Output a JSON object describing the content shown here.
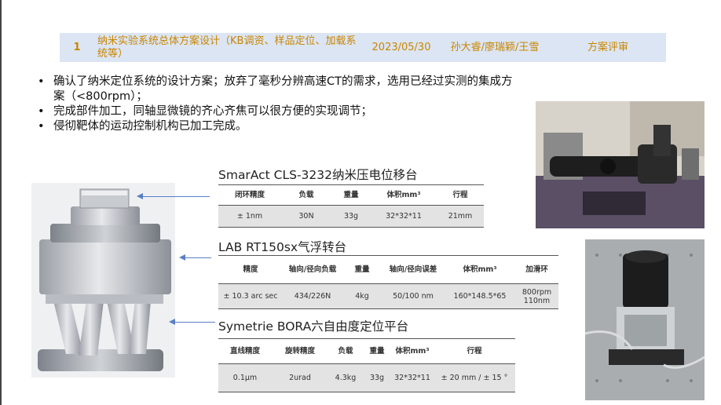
{
  "header_row": {
    "number": "1",
    "title": "纳米实验系统总体方案设计（KB调资、样品定位、加载系统等）",
    "date": "2023/05/30",
    "people": "孙大睿/廖瑞颖/王雪",
    "review": "方案评审"
  },
  "bullets": [
    "确认了纳米定位系统的设计方案；放弃了毫秒分辨高速CT的需求，选用已经过实测的集成方案（<800rpm）；",
    "完成部件加工，同轴显微镜的齐心齐焦可以很方便的实现调节；",
    "侵彻靶体的运动控制机构已加工完成。"
  ],
  "sections": [
    {
      "title": "SmarAct CLS-3232纳米压电位移台",
      "headers": [
        "闭环精度",
        "负载",
        "重量",
        "体积mm³",
        "行程"
      ],
      "row": [
        "± 1nm",
        "30N",
        "33g",
        "32*32*11",
        "21mm"
      ]
    },
    {
      "title": "LAB RT150sx气浮转台",
      "headers": [
        "精度",
        "轴向/径向负载",
        "重量",
        "轴向/径向误差",
        "体积mm³",
        "加滑环"
      ],
      "row": [
        "± 10.3 arc sec",
        "434/226N",
        "4kg",
        "50/100 nm",
        "160*148.5*65",
        "800rpm 110nm"
      ]
    },
    {
      "title": "Symetrie BORA六自由度定位平台",
      "headers": [
        "直线精度",
        "旋转精度",
        "负载",
        "重量",
        "体积mm³",
        "行程"
      ],
      "row": [
        "0.1μm",
        "2urad",
        "4.3kg",
        "33g",
        "32*32*11",
        "± 20 mm / ± 15 °"
      ]
    }
  ],
  "colors": {
    "header_bg": "#dbe5f3",
    "header_text": "#c98500",
    "arrow": "#5b7fc4"
  }
}
